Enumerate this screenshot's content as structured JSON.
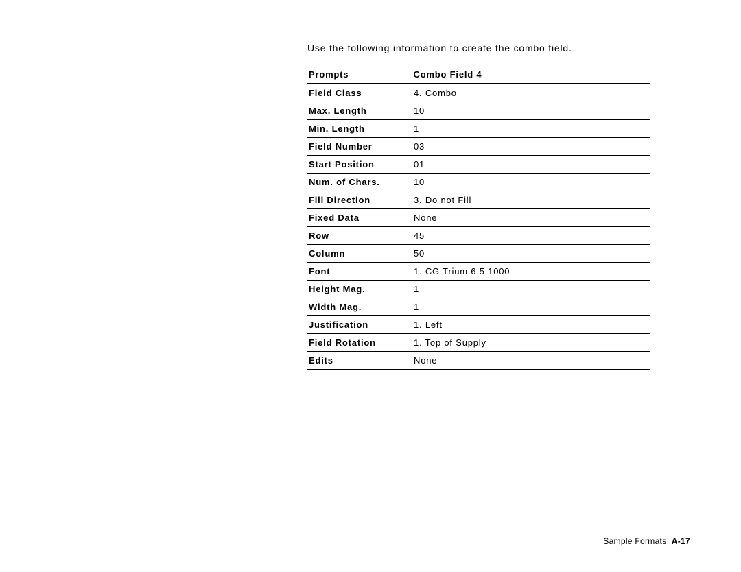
{
  "intro": "Use the following information to create the combo field.",
  "table": {
    "head": {
      "prompts": "Prompts",
      "value": "Combo Field 4"
    },
    "rows": [
      {
        "label": "Field Class",
        "value": "4. Combo"
      },
      {
        "label": "Max. Length",
        "value": "10"
      },
      {
        "label": "Min. Length",
        "value": "1"
      },
      {
        "label": "Field Number",
        "value": "03"
      },
      {
        "label": "Start Position",
        "value": "01"
      },
      {
        "label": "Num. of Chars.",
        "value": "10"
      },
      {
        "label": "Fill Direction",
        "value": "3. Do not Fill"
      },
      {
        "label": "Fixed Data",
        "value": "None"
      },
      {
        "label": "Row",
        "value": "45"
      },
      {
        "label": "Column",
        "value": "50"
      },
      {
        "label": "Font",
        "value": "1. CG Trium 6.5 1000"
      },
      {
        "label": "Height Mag.",
        "value": "1"
      },
      {
        "label": "Width Mag.",
        "value": "1"
      },
      {
        "label": "Justification",
        "value": "1. Left"
      },
      {
        "label": "Field Rotation",
        "value": "1. Top of Supply"
      },
      {
        "label": "Edits",
        "value": "None"
      }
    ]
  },
  "footer": {
    "section": "Sample Formats",
    "page": "A-17"
  }
}
